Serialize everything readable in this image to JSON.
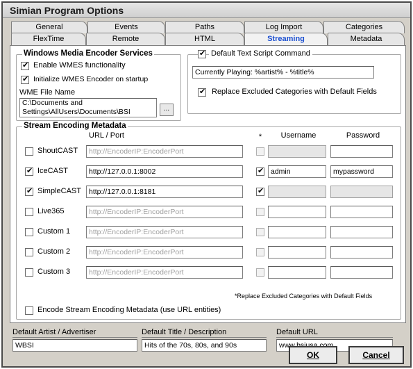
{
  "window": {
    "title": "Simian Program Options"
  },
  "tabs": {
    "row1": [
      {
        "label": "General"
      },
      {
        "label": "Events"
      },
      {
        "label": "Paths"
      },
      {
        "label": "Log Import"
      },
      {
        "label": "Categories"
      }
    ],
    "row2": [
      {
        "label": "FlexTime"
      },
      {
        "label": "Remote"
      },
      {
        "label": "HTML"
      },
      {
        "label": "Streaming",
        "active": true
      },
      {
        "label": "Metadata"
      }
    ]
  },
  "wmes": {
    "title": "Windows Media Encoder Services",
    "enable_label": "Enable WMES functionality",
    "enable_checked": true,
    "init_label": "Initialize WMES Encoder on startup",
    "init_checked": true,
    "file_label": "WME File Name",
    "file_value": "C:\\Documents and Settings\\AllUsers\\Documents\\BSI",
    "browse_label": "..."
  },
  "text_script": {
    "label": "Default Text Script Command",
    "checked": true,
    "value": "Currently Playing: %artist% - %title%",
    "replace_label": "Replace Excluded Categories with Default Fields",
    "replace_checked": true
  },
  "stream": {
    "title": "Stream Encoding Metadata",
    "hdr_url": "URL / Port",
    "hdr_star": "*",
    "hdr_user": "Username",
    "hdr_pass": "Password",
    "rows": [
      {
        "name": "ShoutCAST",
        "checked": false,
        "url": "http://EncoderIP:EncoderPort",
        "url_disabled": true,
        "star": false,
        "user": "",
        "pass": ""
      },
      {
        "name": "IceCAST",
        "checked": true,
        "url": "http://127.0.0.1:8002",
        "url_disabled": false,
        "star": true,
        "user": "admin",
        "pass": "mypassword"
      },
      {
        "name": "SimpleCAST",
        "checked": true,
        "url": "http://127.0.0.1:8181",
        "url_disabled": false,
        "star": true,
        "user": "",
        "pass": ""
      },
      {
        "name": "Live365",
        "checked": false,
        "url": "http://EncoderIP:EncoderPort",
        "url_disabled": true,
        "star": false,
        "user": "",
        "pass": ""
      },
      {
        "name": "Custom 1",
        "checked": false,
        "url": "http://EncoderIP:EncoderPort",
        "url_disabled": true,
        "star": false,
        "user": "",
        "pass": ""
      },
      {
        "name": "Custom 2",
        "checked": false,
        "url": "http://EncoderIP:EncoderPort",
        "url_disabled": true,
        "star": false,
        "user": "",
        "pass": ""
      },
      {
        "name": "Custom 3",
        "checked": false,
        "url": "http://EncoderIP:EncoderPort",
        "url_disabled": true,
        "star": false,
        "user": "",
        "pass": ""
      }
    ],
    "note": "*Replace Excluded Categories with Default Fields",
    "encode_label": "Encode Stream Encoding Metadata (use URL entities)",
    "encode_checked": false
  },
  "defaults": {
    "artist_label": "Default Artist / Advertiser",
    "artist_value": "WBSI",
    "title_label": "Default Title / Description",
    "title_value": "Hits of the 70s, 80s, and 90s",
    "url_label": "Default URL",
    "url_value": "www.bsiusa.com"
  },
  "buttons": {
    "ok": "OK",
    "cancel": "Cancel"
  }
}
